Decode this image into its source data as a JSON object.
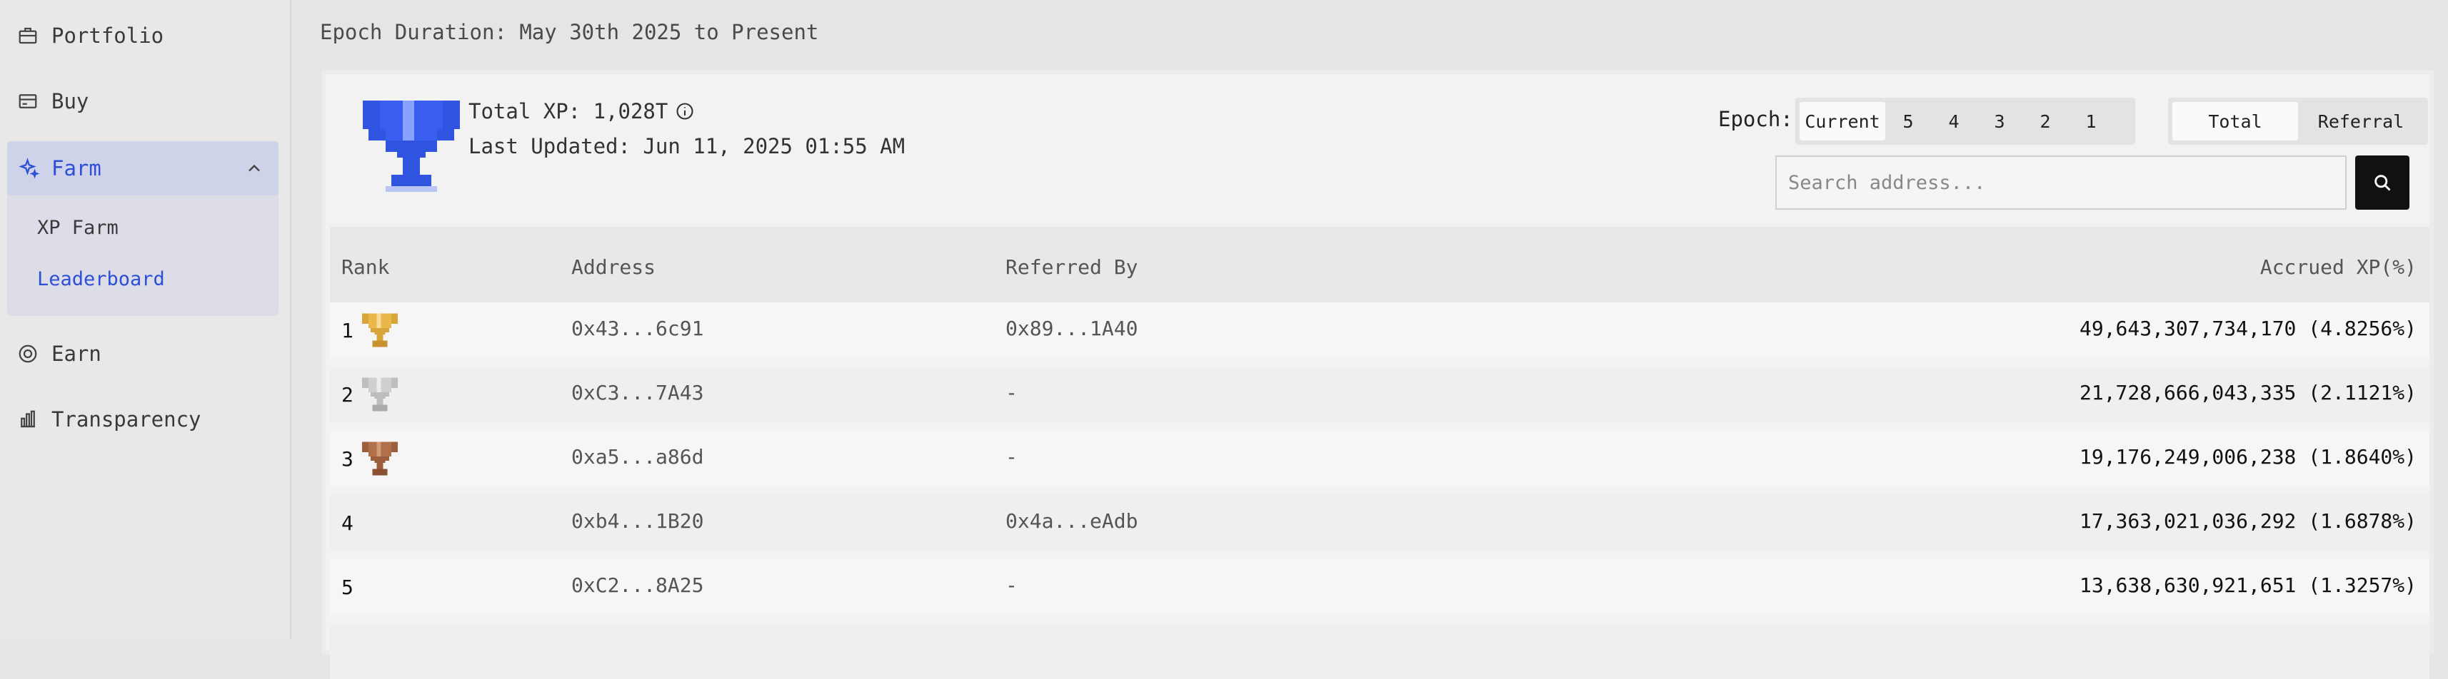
{
  "sidebar": {
    "items": [
      {
        "label": "Portfolio",
        "icon": "briefcase-icon"
      },
      {
        "label": "Buy",
        "icon": "card-icon"
      },
      {
        "label": "Farm",
        "icon": "sparkle-icon"
      },
      {
        "label": "Earn",
        "icon": "coin-icon"
      },
      {
        "label": "Transparency",
        "icon": "bar-chart-icon"
      }
    ],
    "farm_sub": [
      {
        "label": "XP Farm"
      },
      {
        "label": "Leaderboard"
      }
    ]
  },
  "header": {
    "epoch_duration": "Epoch Duration: May 30th 2025 to Present"
  },
  "summary": {
    "total_xp": "Total XP: 1,028T",
    "last_updated": "Last Updated: Jun 11, 2025 01:55 AM"
  },
  "filters": {
    "epoch_label": "Epoch:",
    "epoch_tabs": [
      "Current",
      "5",
      "4",
      "3",
      "2",
      "1"
    ],
    "mode_tabs": [
      "Total",
      "Referral"
    ],
    "search_placeholder": "Search address..."
  },
  "table": {
    "headers": {
      "rank": "Rank",
      "address": "Address",
      "referred_by": "Referred By",
      "accrued": "Accrued XP(%)"
    },
    "rows": [
      {
        "rank": "1",
        "address": "0x43...6c91",
        "referred_by": "0x89...1A40",
        "accrued": "49,643,307,734,170 (4.8256%)",
        "trophy": "gold"
      },
      {
        "rank": "2",
        "address": "0xC3...7A43",
        "referred_by": "-",
        "accrued": "21,728,666,043,335 (2.1121%)",
        "trophy": "silver"
      },
      {
        "rank": "3",
        "address": "0xa5...a86d",
        "referred_by": "-",
        "accrued": "19,176,249,006,238 (1.8640%)",
        "trophy": "bronze"
      },
      {
        "rank": "4",
        "address": "0xb4...1B20",
        "referred_by": "0x4a...eAdb",
        "accrued": "17,363,021,036,292 (1.6878%)",
        "trophy": ""
      },
      {
        "rank": "5",
        "address": "0xC2...8A25",
        "referred_by": "-",
        "accrued": "13,638,630,921,651 (1.3257%)",
        "trophy": ""
      }
    ]
  },
  "colors": {
    "accent": "#2d4fd6",
    "gold": "#e9b84a",
    "silver": "#c9c9c9",
    "bronze": "#b0704a"
  }
}
